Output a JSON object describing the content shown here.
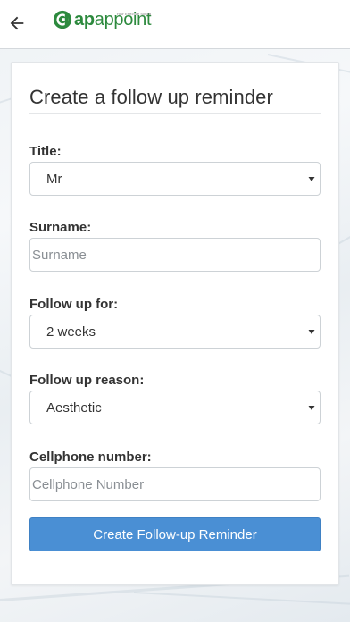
{
  "header": {
    "back_icon": "arrow-left-icon",
    "logo": {
      "icon": "apappoint-logo-icon",
      "text_ap": "ap",
      "text_appoint": "appoint",
      "tagline": "Your Effective Sched",
      "brand_color": "#2d8a3e"
    }
  },
  "form": {
    "title": "Create a follow up reminder",
    "title_field": {
      "label": "Title:",
      "value": "Mr"
    },
    "surname_field": {
      "label": "Surname:",
      "placeholder": "Surname",
      "value": ""
    },
    "follow_up_for_field": {
      "label": "Follow up for:",
      "value": "2 weeks"
    },
    "follow_up_reason_field": {
      "label": "Follow up reason:",
      "value": "Aesthetic"
    },
    "cellphone_field": {
      "label": "Cellphone number:",
      "placeholder": "Cellphone Number",
      "value": ""
    },
    "submit_label": "Create Follow-up Reminder",
    "submit_color": "#4a8fd4"
  }
}
